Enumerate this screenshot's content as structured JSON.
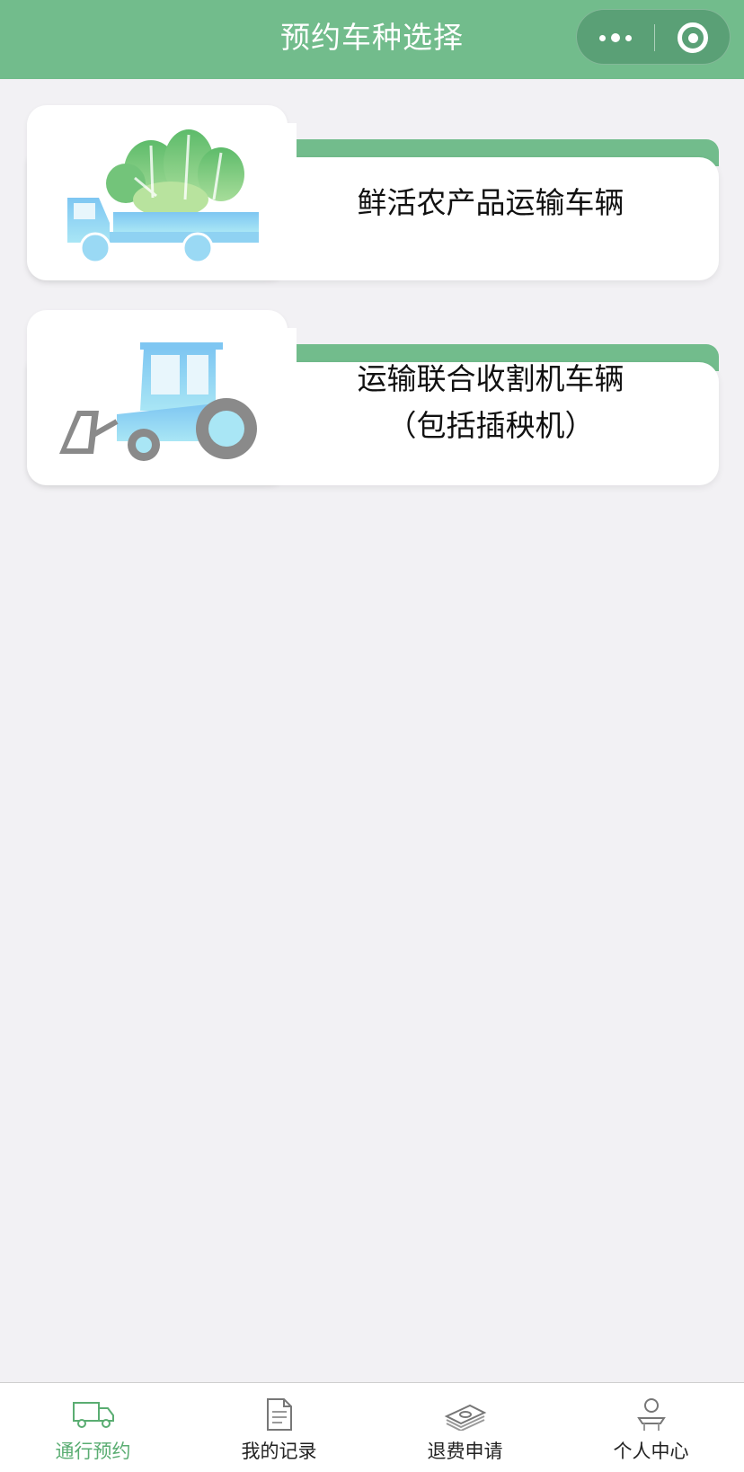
{
  "header": {
    "title": "预约车种选择",
    "accent_color": "#72bc8c"
  },
  "capsule": {
    "more_icon": "more-dots-icon",
    "close_icon": "target-circle-icon"
  },
  "cards": [
    {
      "label": "鲜活农产品运输车辆",
      "icon": "produce-truck-icon"
    },
    {
      "label_line1": "运输联合收割机车辆",
      "label_line2": "（包括插秧机）",
      "icon": "tractor-icon"
    }
  ],
  "tabbar": {
    "items": [
      {
        "label": "通行预约",
        "icon": "truck-icon",
        "active": true
      },
      {
        "label": "我的记录",
        "icon": "document-icon",
        "active": false
      },
      {
        "label": "退费申请",
        "icon": "money-icon",
        "active": false
      },
      {
        "label": "个人中心",
        "icon": "person-icon",
        "active": false
      }
    ],
    "active_color": "#5aad72"
  }
}
